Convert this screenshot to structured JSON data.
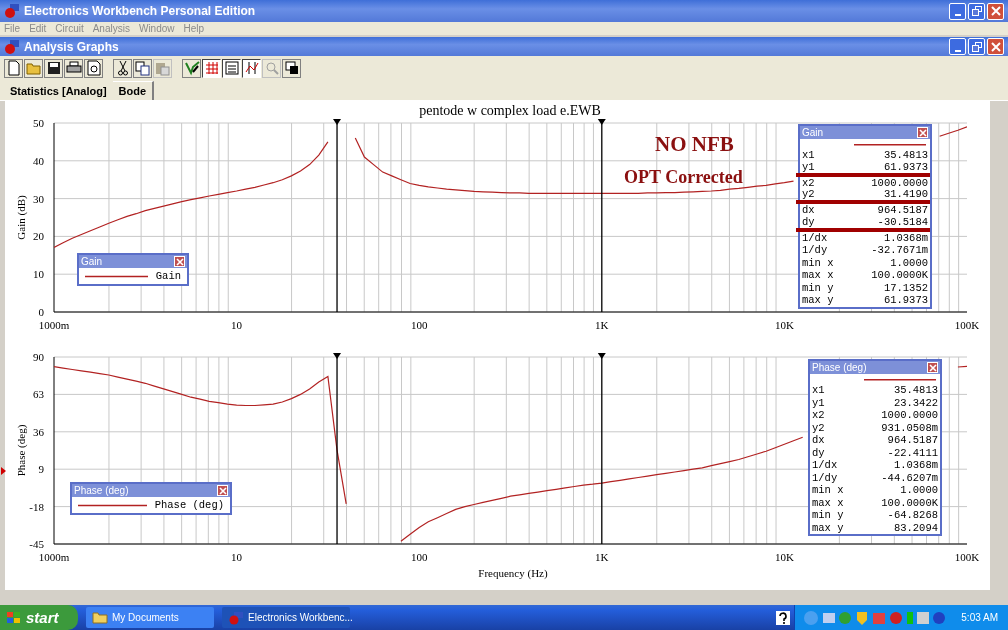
{
  "window": {
    "title": "Electronics Workbench Personal Edition"
  },
  "menu": [
    {
      "label": "File",
      "disabled": true
    },
    {
      "label": "Edit",
      "disabled": true
    },
    {
      "label": "Circuit",
      "disabled": true
    },
    {
      "label": "Analysis",
      "disabled": true
    },
    {
      "label": "Window",
      "disabled": true
    },
    {
      "label": "Help",
      "disabled": true
    }
  ],
  "child_window": {
    "title": "Analysis Graphs"
  },
  "toolbar": [
    {
      "kind": "new",
      "pressed": false,
      "disabled": false
    },
    {
      "kind": "open",
      "pressed": false,
      "disabled": false
    },
    {
      "kind": "save",
      "pressed": false,
      "disabled": false
    },
    {
      "kind": "print",
      "pressed": false,
      "disabled": false
    },
    {
      "kind": "preview",
      "pressed": false,
      "disabled": false
    },
    {
      "kind": "cut",
      "pressed": false,
      "disabled": false
    },
    {
      "kind": "copy",
      "pressed": false,
      "disabled": false
    },
    {
      "kind": "paste",
      "pressed": false,
      "disabled": true
    },
    {
      "kind": "properties",
      "pressed": false,
      "disabled": false
    },
    {
      "kind": "grid",
      "pressed": true,
      "disabled": false
    },
    {
      "kind": "legend",
      "pressed": true,
      "disabled": false
    },
    {
      "kind": "cursors",
      "pressed": true,
      "disabled": false
    },
    {
      "kind": "zoom",
      "pressed": false,
      "disabled": true
    },
    {
      "kind": "reverse",
      "pressed": false,
      "disabled": false
    }
  ],
  "tabs": [
    {
      "label": "Statistics [Analog]",
      "selected": false
    },
    {
      "label": "Bode",
      "selected": true
    }
  ],
  "graph": {
    "title": "pentode w complex load e.EWB",
    "notes": [
      "NO NFB",
      "OPT Corrected"
    ],
    "panels": [
      {
        "chart_data": {
          "type": "line",
          "ylabel": "Gain (dB)",
          "categories": [
            "1000m",
            null,
            null,
            null,
            null,
            null,
            null,
            null,
            null,
            null,
            null,
            null,
            null,
            null,
            null,
            null,
            null,
            null,
            null,
            null,
            "10",
            null,
            null,
            null,
            null,
            null,
            null,
            null,
            null,
            null,
            null,
            null,
            null,
            null,
            null,
            null,
            null,
            null,
            null,
            null,
            "100",
            null,
            null,
            null,
            null,
            null,
            null,
            null,
            null,
            null,
            null,
            null,
            null,
            null,
            null,
            null,
            null,
            null,
            null,
            null,
            "1K",
            null,
            null,
            null,
            null,
            null,
            null,
            null,
            null,
            null,
            null,
            null,
            null,
            null,
            null,
            null,
            null,
            null,
            null,
            null,
            "10K",
            null,
            null,
            null,
            null,
            null,
            null,
            null,
            null,
            null,
            null,
            null,
            null,
            null,
            null,
            null,
            null,
            null,
            null,
            null,
            "100K"
          ],
          "series": [
            {
              "name": "Gain",
              "color": "#b22222",
              "values": [
                17.1,
                18.3,
                19.5,
                20.5,
                21.5,
                22.5,
                23.5,
                24.4,
                25.3,
                26,
                26.8,
                27.4,
                28,
                28.6,
                29.2,
                29.7,
                30.2,
                30.7,
                31.1,
                31.6,
                32,
                32.5,
                33,
                33.6,
                34.2,
                35,
                36,
                37.3,
                39,
                41.5,
                45,
                null,
                null,
                46,
                41,
                39,
                37,
                36,
                35,
                34,
                33.5,
                33.1,
                32.8,
                32.5,
                32.3,
                32.1,
                31.9,
                31.8,
                31.7,
                31.6,
                31.5,
                31.5,
                31.4,
                31.4,
                31.4,
                31.4,
                31.4,
                31.4,
                31.4,
                31.4,
                31.4,
                31.4,
                31.4,
                31.4,
                31.4,
                31.5,
                31.5,
                31.6,
                31.6,
                31.7,
                31.8,
                31.9,
                32,
                32.2,
                32.5,
                32.7,
                33,
                33.3,
                33.5,
                33.9,
                34.2,
                34.6,
                null,
                null,
                null,
                null,
                null,
                null,
                null,
                null,
                null,
                null,
                null,
                null,
                null,
                null,
                null,
                46.5,
                47.3,
                48.1,
                49
              ]
            }
          ],
          "grid": true,
          "ylim": [
            0,
            50
          ],
          "yticks": [
            0,
            10,
            20,
            30,
            40,
            50
          ]
        },
        "legend": {
          "title": "Gain"
        },
        "cursor_table": {
          "title": "Gain",
          "rows": [
            {
              "label": "x1",
              "value": "35.4813",
              "underlined": false
            },
            {
              "label": "y1",
              "value": "61.9373",
              "underlined": true
            },
            {
              "label": "x2",
              "value": "1000.0000",
              "underlined": false
            },
            {
              "label": "y2",
              "value": "31.4190",
              "underlined": true
            },
            {
              "label": "dx",
              "value": "964.5187",
              "underlined": false
            },
            {
              "label": "dy",
              "value": "-30.5184",
              "underlined": true
            },
            {
              "label": "1/dx",
              "value": "1.0368m",
              "underlined": false
            },
            {
              "label": "1/dy",
              "value": "-32.7671m",
              "underlined": false
            },
            {
              "label": "min x",
              "value": "1.0000",
              "underlined": false
            },
            {
              "label": "max x",
              "value": "100.0000K",
              "underlined": false
            },
            {
              "label": "min y",
              "value": "17.1352",
              "underlined": false
            },
            {
              "label": "max y",
              "value": "61.9373",
              "underlined": false
            }
          ]
        }
      },
      {
        "chart_data": {
          "type": "line",
          "xlabel": "Frequency (Hz)",
          "ylabel": "Phase (deg)",
          "categories": [
            "1000m",
            null,
            null,
            null,
            null,
            null,
            null,
            null,
            null,
            null,
            null,
            null,
            null,
            null,
            null,
            null,
            null,
            null,
            null,
            null,
            "10",
            null,
            null,
            null,
            null,
            null,
            null,
            null,
            null,
            null,
            null,
            null,
            null,
            null,
            null,
            null,
            null,
            null,
            null,
            null,
            "100",
            null,
            null,
            null,
            null,
            null,
            null,
            null,
            null,
            null,
            null,
            null,
            null,
            null,
            null,
            null,
            null,
            null,
            null,
            null,
            "1K",
            null,
            null,
            null,
            null,
            null,
            null,
            null,
            null,
            null,
            null,
            null,
            null,
            null,
            null,
            null,
            null,
            null,
            null,
            null,
            "10K",
            null,
            null,
            null,
            null,
            null,
            null,
            null,
            null,
            null,
            null,
            null,
            null,
            null,
            null,
            null,
            null,
            null,
            null,
            null,
            "100K"
          ],
          "series": [
            {
              "name": "Phase (deg)",
              "color": "#b22222",
              "values": [
                83,
                82,
                81,
                80,
                79,
                78,
                77,
                75.5,
                74,
                72.5,
                71,
                69,
                67,
                65,
                63,
                61,
                59.5,
                58,
                57,
                56,
                55.3,
                55,
                55,
                55.5,
                56,
                57.5,
                60,
                63,
                67,
                72,
                76,
                23,
                -16,
                null,
                null,
                null,
                null,
                null,
                -43,
                -38,
                -33,
                -29,
                -26,
                -23,
                -20,
                -18,
                -16.5,
                -15,
                -13.5,
                -12,
                -10.5,
                -9.5,
                -8.5,
                -7.5,
                -6.5,
                -5.5,
                -4.5,
                -3.5,
                -2.5,
                -1.8,
                -1,
                0,
                1,
                2,
                3,
                4,
                5,
                6,
                7,
                8,
                9,
                10,
                11.5,
                13,
                14.5,
                16,
                18,
                20,
                22,
                24.5,
                27,
                29.5,
                32,
                null,
                null,
                null,
                null,
                null,
                null,
                null,
                null,
                null,
                null,
                null,
                null,
                null,
                null,
                null,
                null,
                82.8,
                83.2
              ]
            }
          ],
          "grid": true,
          "ylim": [
            -45,
            90
          ],
          "yticks": [
            -45,
            -18,
            9,
            36,
            63,
            90
          ]
        },
        "legend": {
          "title": "Phase (deg)"
        },
        "cursor_table": {
          "title": "Phase (deg)",
          "rows": [
            {
              "label": "x1",
              "value": "35.4813",
              "underlined": false
            },
            {
              "label": "y1",
              "value": "23.3422",
              "underlined": false
            },
            {
              "label": "x2",
              "value": "1000.0000",
              "underlined": false
            },
            {
              "label": "y2",
              "value": "931.0508m",
              "underlined": false
            },
            {
              "label": "dx",
              "value": "964.5187",
              "underlined": false
            },
            {
              "label": "dy",
              "value": "-22.4111",
              "underlined": false
            },
            {
              "label": "1/dx",
              "value": "1.0368m",
              "underlined": false
            },
            {
              "label": "1/dy",
              "value": "-44.6207m",
              "underlined": false
            },
            {
              "label": "min x",
              "value": "1.0000",
              "underlined": false
            },
            {
              "label": "max x",
              "value": "100.0000K",
              "underlined": false
            },
            {
              "label": "min y",
              "value": "-64.8268",
              "underlined": false
            },
            {
              "label": "max y",
              "value": "83.2094",
              "underlined": false
            }
          ]
        }
      }
    ]
  },
  "taskbar": {
    "start": "start",
    "tasks": [
      {
        "label": "My Documents",
        "selected": false
      },
      {
        "label": "Electronics Workbenc...",
        "selected": true
      }
    ],
    "clock": "5:03 AM"
  }
}
